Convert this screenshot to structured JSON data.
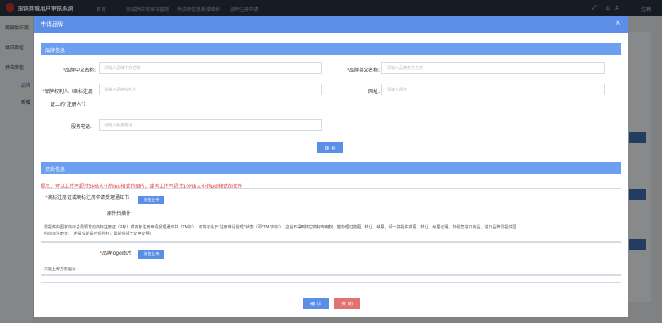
{
  "app": {
    "title": "国铁商城用户审核系统",
    "breadcrumb": [
      "首页",
      "商城供应商审核管理",
      "供应商信息新增维护",
      "品牌注册申请"
    ],
    "user": "注销"
  },
  "sidebar": {
    "items": [
      "商城供应商",
      "供应商信",
      "供应商信",
      "品牌",
      "新增"
    ]
  },
  "modal": {
    "title": "申请品牌",
    "close_icon": "×",
    "brand_section": {
      "title": "品牌信息",
      "fields": {
        "cn_name": {
          "label": "品牌中文名称:",
          "placeholder": "请输入品牌中文名称"
        },
        "en_name": {
          "label": "品牌英文名称:",
          "placeholder": "请输入品牌英文名称"
        },
        "owner": {
          "label_line1": "品牌权利人（商标注册",
          "label_line2": "证上的\"注册人\"）:",
          "placeholder": "请输入品牌权利人"
        },
        "website": {
          "label": "网址:",
          "placeholder": "请输入网址"
        },
        "phone": {
          "label": "服务电话:",
          "placeholder": "请输入服务电话"
        }
      },
      "save_label": "保 存"
    },
    "qual_section": {
      "title": "资质信息",
      "tip": "提示：可以上传不超过3MB大小的jpg格式的图片，或者上传不超过10MB大小的pdf格式的文件",
      "cert": {
        "label": "商标注册证或商标注册申请受理通知书",
        "sublabel": "原件扫描件",
        "upload_label": "点击上传",
        "desc_line1": "需提供由国家商标总局颁发的商标注册证（R标）或商标注册申请受理通知书（TM标），如商标处于\"注册申请受理\"状态（即\"TM\"商标），应当不得到其它商标专用权。若办理过变更、转让、续展，请一并提供变更、转让、续展证明。如经营进口商品，进口品牌需提供国",
        "desc_line2": "内商标注册证。（若提交的是合理授权，需提供领土证申证明）"
      },
      "logo": {
        "label": "品牌logo图片",
        "upload_label": "点击上传",
        "hint": "只能上传方形图片"
      }
    },
    "confirm_label": "确 认",
    "close_label": "关 闭"
  },
  "colors": {
    "header": "#5b8ee6",
    "section": "#6c9fef",
    "danger": "#e27272",
    "tip": "#e03b3b"
  }
}
